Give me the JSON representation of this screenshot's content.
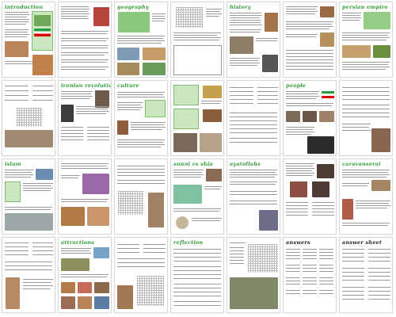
{
  "pages": [
    {
      "title": "introduction"
    },
    {
      "title": ""
    },
    {
      "title": "geography"
    },
    {
      "title": ""
    },
    {
      "title": "history"
    },
    {
      "title": ""
    },
    {
      "title": "persian empire"
    },
    {
      "title": ""
    },
    {
      "title": "iranian revolution"
    },
    {
      "title": "culture"
    },
    {
      "title": ""
    },
    {
      "title": ""
    },
    {
      "title": "people"
    },
    {
      "title": ""
    },
    {
      "title": "islam"
    },
    {
      "title": ""
    },
    {
      "title": ""
    },
    {
      "title": "sunni vs shia"
    },
    {
      "title": "ayatollahs"
    },
    {
      "title": ""
    },
    {
      "title": "caravanserai"
    },
    {
      "title": ""
    },
    {
      "title": "attractions"
    },
    {
      "title": ""
    },
    {
      "title": "reflection"
    },
    {
      "title": ""
    },
    {
      "title": "answers"
    },
    {
      "title": "answer sheet"
    }
  ]
}
